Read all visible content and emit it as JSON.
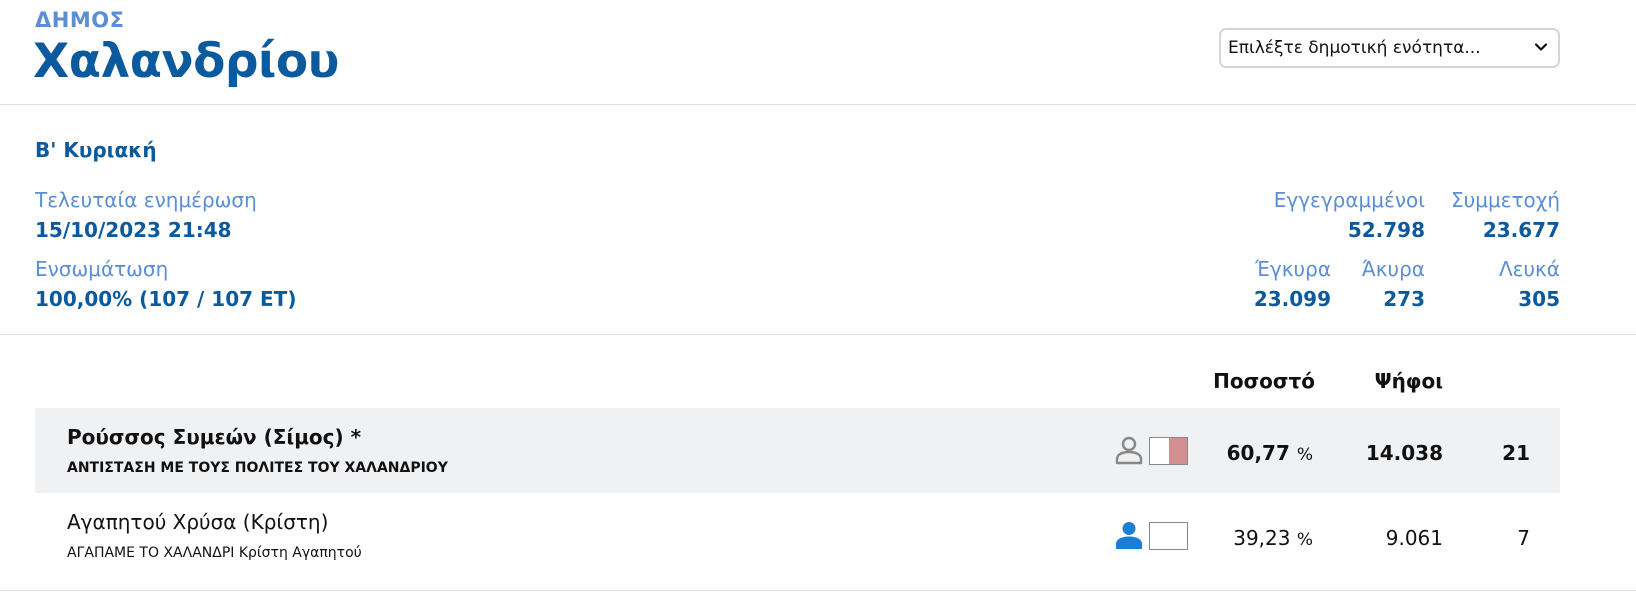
{
  "header": {
    "municipality_prefix": "ΔΗΜΟΣ",
    "municipality_name": "Χαλανδρίου",
    "unit_select": {
      "value": "Επιλέξτε δημοτική ενότητα..."
    }
  },
  "info": {
    "round": "Β' Κυριακή",
    "last_update_label": "Τελευταία ενημέρωση",
    "last_update_value": "15/10/2023 21:48",
    "incorporation_label": "Ενσωμάτωση",
    "incorporation_value": "100,00% (107 / 107 ΕΤ)",
    "registered_label": "Εγγεγραμμένοι",
    "registered_value": "52.798",
    "turnout_label": "Συμμετοχή",
    "turnout_value": "23.677",
    "valid_label": "Έγκυρα",
    "valid_value": "23.099",
    "invalid_label": "Άκυρα",
    "invalid_value": "273",
    "blank_label": "Λευκά",
    "blank_value": "305"
  },
  "results": {
    "columns": {
      "percent": "Ποσοστό",
      "votes": "Ψήφοι"
    },
    "candidates": [
      {
        "name": "Ρούσσος Συμεών (Σίμος) *",
        "party": "ΑΝΤΙΣΤΑΣΗ ΜΕ ΤΟΥΣ ΠΟΛΙΤΕΣ ΤΟΥ ΧΑΛΑΝΔΡΙΟΥ",
        "percent": "60,77",
        "percent_unit": "%",
        "votes": "14.038",
        "seats": "21",
        "icon": "person-outline-icon",
        "bar_fill": 0.5,
        "bar_color": "#d48f90"
      },
      {
        "name": "Αγαπητού Χρύσα (Κρίστη)",
        "party": "ΑΓΑΠΑΜΕ ΤΟ ΧΑΛΑΝΔΡΙ Κρίστη Αγαπητού",
        "percent": "39,23",
        "percent_unit": "%",
        "votes": "9.061",
        "seats": "7",
        "icon": "person-filled-icon",
        "bar_fill": 0,
        "bar_color": "#d48f90"
      }
    ]
  },
  "colors": {
    "title_blue": "#0b5a9d",
    "label_blue": "#5b8ed4",
    "filled_person": "#1a7fd4",
    "outline_person": "#888888"
  }
}
